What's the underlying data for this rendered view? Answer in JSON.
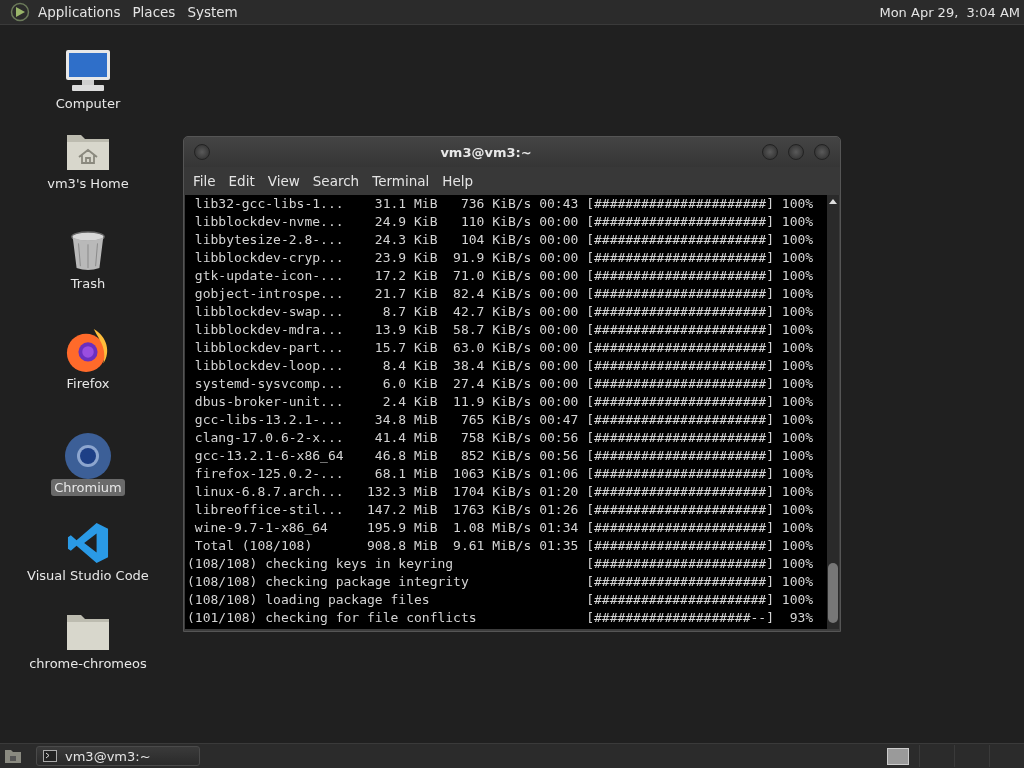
{
  "top_panel": {
    "menus": [
      "Applications",
      "Places",
      "System"
    ],
    "clock": "Mon Apr 29,  3:04 AM"
  },
  "desktop_icons": [
    {
      "kind": "computer",
      "label": "Computer",
      "selected": false
    },
    {
      "kind": "home",
      "label": "vm3's Home",
      "selected": false
    },
    {
      "kind": "trash",
      "label": "Trash",
      "selected": false
    },
    {
      "kind": "firefox",
      "label": "Firefox",
      "selected": false
    },
    {
      "kind": "chromium",
      "label": "Chromium",
      "selected": true
    },
    {
      "kind": "vscode",
      "label": "Visual Studio Code",
      "selected": false
    },
    {
      "kind": "folder",
      "label": "chrome-chromeos",
      "selected": false
    }
  ],
  "window": {
    "title": "vm3@vm3:~",
    "menu": [
      "File",
      "Edit",
      "View",
      "Search",
      "Terminal",
      "Help"
    ],
    "lines": [
      {
        "kind": "download",
        "name": "lib32-gcc-libs-1...",
        "size": "31.1 MiB",
        "rate": "736 KiB/s",
        "time": "00:43",
        "bar": "[######################]",
        "percent": "100%"
      },
      {
        "kind": "download",
        "name": "libblockdev-nvme...",
        "size": "24.9 KiB",
        "rate": "110 KiB/s",
        "time": "00:00",
        "bar": "[######################]",
        "percent": "100%"
      },
      {
        "kind": "download",
        "name": "libbytesize-2.8-...",
        "size": "24.3 KiB",
        "rate": "104 KiB/s",
        "time": "00:00",
        "bar": "[######################]",
        "percent": "100%"
      },
      {
        "kind": "download",
        "name": "libblockdev-cryp...",
        "size": "23.9 KiB",
        "rate": "91.9 KiB/s",
        "time": "00:00",
        "bar": "[######################]",
        "percent": "100%"
      },
      {
        "kind": "download",
        "name": "gtk-update-icon-...",
        "size": "17.2 KiB",
        "rate": "71.0 KiB/s",
        "time": "00:00",
        "bar": "[######################]",
        "percent": "100%"
      },
      {
        "kind": "download",
        "name": "gobject-introspe...",
        "size": "21.7 KiB",
        "rate": "82.4 KiB/s",
        "time": "00:00",
        "bar": "[######################]",
        "percent": "100%"
      },
      {
        "kind": "download",
        "name": "libblockdev-swap...",
        "size": "8.7 KiB",
        "rate": "42.7 KiB/s",
        "time": "00:00",
        "bar": "[######################]",
        "percent": "100%"
      },
      {
        "kind": "download",
        "name": "libblockdev-mdra...",
        "size": "13.9 KiB",
        "rate": "58.7 KiB/s",
        "time": "00:00",
        "bar": "[######################]",
        "percent": "100%"
      },
      {
        "kind": "download",
        "name": "libblockdev-part...",
        "size": "15.7 KiB",
        "rate": "63.0 KiB/s",
        "time": "00:00",
        "bar": "[######################]",
        "percent": "100%"
      },
      {
        "kind": "download",
        "name": "libblockdev-loop...",
        "size": "8.4 KiB",
        "rate": "38.4 KiB/s",
        "time": "00:00",
        "bar": "[######################]",
        "percent": "100%"
      },
      {
        "kind": "download",
        "name": "systemd-sysvcomp...",
        "size": "6.0 KiB",
        "rate": "27.4 KiB/s",
        "time": "00:00",
        "bar": "[######################]",
        "percent": "100%"
      },
      {
        "kind": "download",
        "name": "dbus-broker-unit...",
        "size": "2.4 KiB",
        "rate": "11.9 KiB/s",
        "time": "00:00",
        "bar": "[######################]",
        "percent": "100%"
      },
      {
        "kind": "download",
        "name": "gcc-libs-13.2.1-...",
        "size": "34.8 MiB",
        "rate": "765 KiB/s",
        "time": "00:47",
        "bar": "[######################]",
        "percent": "100%"
      },
      {
        "kind": "download",
        "name": "clang-17.0.6-2-x...",
        "size": "41.4 MiB",
        "rate": "758 KiB/s",
        "time": "00:56",
        "bar": "[######################]",
        "percent": "100%"
      },
      {
        "kind": "download",
        "name": "gcc-13.2.1-6-x86_64",
        "size": "46.8 MiB",
        "rate": "852 KiB/s",
        "time": "00:56",
        "bar": "[######################]",
        "percent": "100%"
      },
      {
        "kind": "download",
        "name": "firefox-125.0.2-...",
        "size": "68.1 MiB",
        "rate": "1063 KiB/s",
        "time": "01:06",
        "bar": "[######################]",
        "percent": "100%"
      },
      {
        "kind": "download",
        "name": "linux-6.8.7.arch...",
        "size": "132.3 MiB",
        "rate": "1704 KiB/s",
        "time": "01:20",
        "bar": "[######################]",
        "percent": "100%"
      },
      {
        "kind": "download",
        "name": "libreoffice-stil...",
        "size": "147.2 MiB",
        "rate": "1763 KiB/s",
        "time": "01:26",
        "bar": "[######################]",
        "percent": "100%"
      },
      {
        "kind": "download",
        "name": "wine-9.7-1-x86_64",
        "size": "195.9 MiB",
        "rate": "1.08 MiB/s",
        "time": "01:34",
        "bar": "[######################]",
        "percent": "100%"
      },
      {
        "kind": "download",
        "name": "Total (108/108)",
        "size": "908.8 MiB",
        "rate": "9.61 MiB/s",
        "time": "01:35",
        "bar": "[######################]",
        "percent": "100%"
      },
      {
        "kind": "check",
        "text": "(108/108) checking keys in keyring",
        "bar": "[######################]",
        "percent": "100%"
      },
      {
        "kind": "check",
        "text": "(108/108) checking package integrity",
        "bar": "[######################]",
        "percent": "100%"
      },
      {
        "kind": "check",
        "text": "(108/108) loading package files",
        "bar": "[######################]",
        "percent": "100%"
      },
      {
        "kind": "check",
        "text": "(101/108) checking for file conflicts",
        "bar": "[####################--]",
        "percent": "93%"
      }
    ]
  },
  "taskbar": {
    "tasks": [
      {
        "label": "vm3@vm3:~",
        "selected": false
      }
    ]
  }
}
